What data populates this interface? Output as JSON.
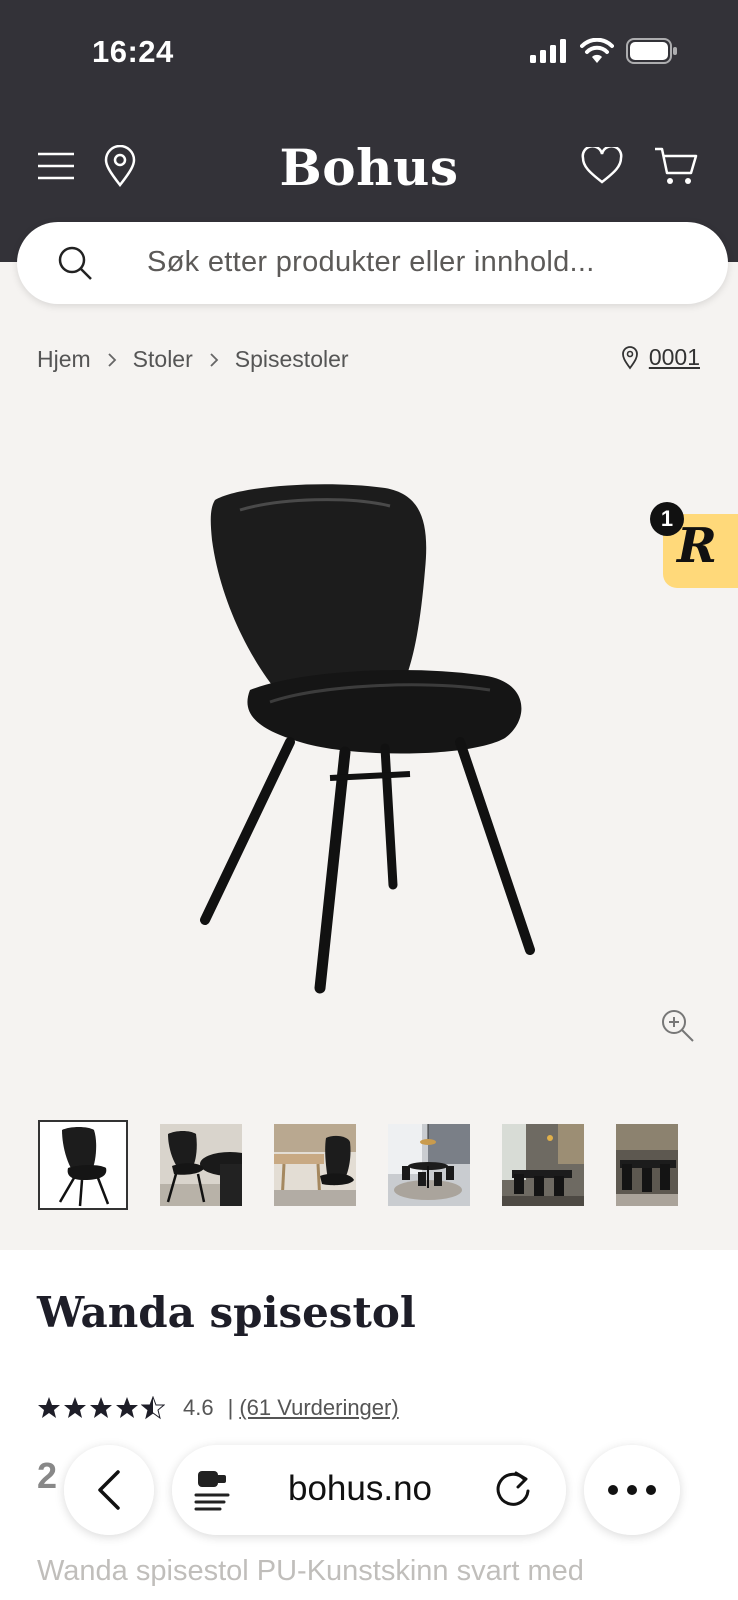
{
  "status": {
    "time": "16:24"
  },
  "header": {
    "brand": "Bohus"
  },
  "search": {
    "placeholder": "Søk etter produkter eller innhold..."
  },
  "breadcrumb": {
    "items": [
      "Hjem",
      "Stoler",
      "Spisestoler"
    ],
    "store": "0001"
  },
  "badge": {
    "count": "1",
    "letter": "R"
  },
  "product": {
    "title": "Wanda spisestol",
    "rating": "4.6",
    "separator": "|",
    "reviews": "(61 Vurderinger)",
    "price_fragment": "2",
    "description": "Wanda spisestol PU-Kunstskinn svart med"
  },
  "browser": {
    "url": "bohus.no"
  },
  "colors": {
    "header_bg": "#333238",
    "page_bg": "#f5f3f1",
    "badge_bg": "#ffd97a"
  }
}
